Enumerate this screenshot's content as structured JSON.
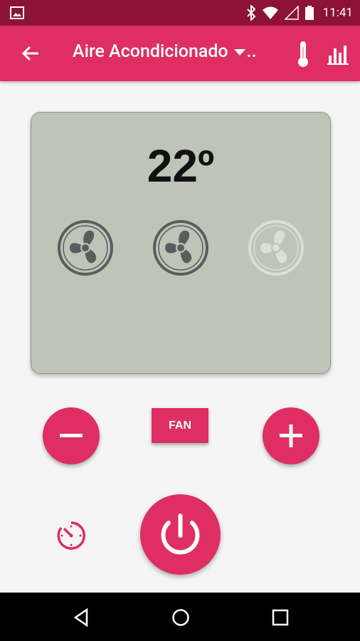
{
  "status_bar": {
    "time": "11:41",
    "icons": [
      "gallery-icon",
      "bluetooth-icon",
      "wifi-icon",
      "cellular-signal-icon",
      "battery-icon"
    ]
  },
  "app_bar": {
    "title": "Aire Acondicionado",
    "title_overflow": "..",
    "icons": [
      "back-arrow-icon",
      "dropdown-caret-icon",
      "thermometer-icon",
      "bar-chart-icon"
    ],
    "color": "#de2e63",
    "status_color": "#8c1237"
  },
  "display": {
    "temperature": "22º",
    "fans": [
      {
        "name": "fan-speed-1",
        "active": true
      },
      {
        "name": "fan-speed-2",
        "active": true
      },
      {
        "name": "fan-speed-3",
        "active": false
      }
    ],
    "background": "#bec4b8"
  },
  "controls": {
    "decrease_icon": "minus-icon",
    "fan_label": "FAN",
    "increase_icon": "plus-icon",
    "timer_icon": "timer-icon",
    "power_icon": "power-icon",
    "accent": "#de2e63"
  },
  "nav_bar": {
    "icons": [
      "back-triangle-icon",
      "home-circle-icon",
      "recents-square-icon"
    ]
  }
}
